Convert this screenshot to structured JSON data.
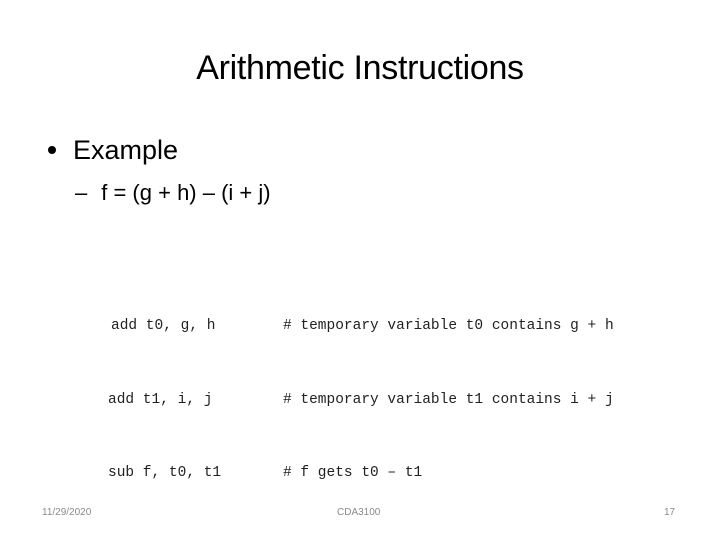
{
  "slide": {
    "title": "Arithmetic Instructions",
    "bullet": "Example",
    "subbullet_dash": "–",
    "subbullet": "f = (g + h) – (i + j)",
    "code_lines": [
      {
        "instruction": "add t0, g, h",
        "comment": "# temporary variable t0 contains g + h"
      },
      {
        "instruction": "add t1, i, j",
        "comment": "# temporary variable t1 contains i + j"
      },
      {
        "instruction": "sub f, t0, t1",
        "comment": "# f gets t0 – t1"
      }
    ]
  },
  "footer": {
    "date": "11/29/2020",
    "course": "CDA3100",
    "page_number": "17"
  }
}
